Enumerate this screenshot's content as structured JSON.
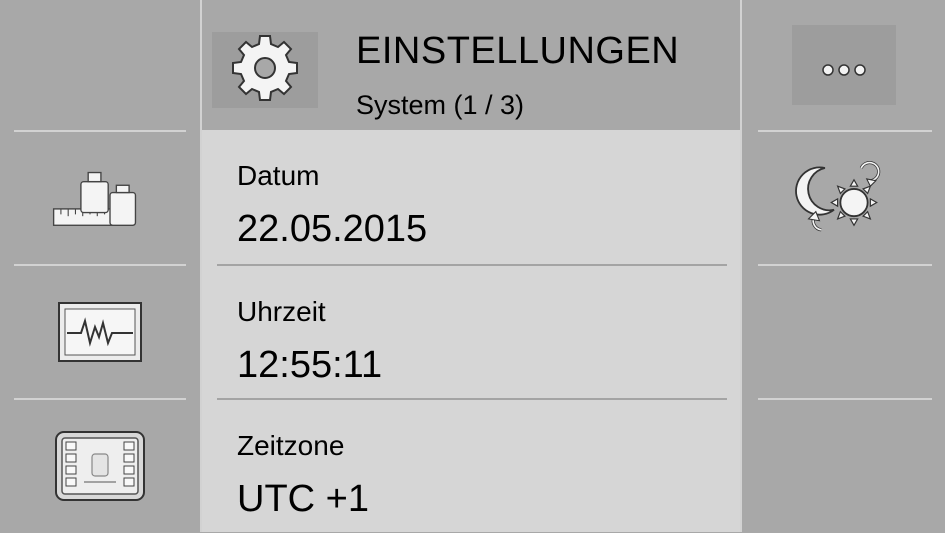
{
  "header": {
    "title": "EINSTELLUNGEN",
    "subtitle": "System (1 / 3)",
    "icon": "gear-icon"
  },
  "settings": [
    {
      "label": "Datum",
      "value": "22.05.2015"
    },
    {
      "label": "Uhrzeit",
      "value": "12:55:11"
    },
    {
      "label": "Zeitzone",
      "value": "UTC +1"
    }
  ],
  "left_buttons": [
    {
      "icon": "weights-scale-icon"
    },
    {
      "icon": "monitor-waveform-icon"
    },
    {
      "icon": "terminal-display-icon"
    }
  ],
  "right_buttons": [
    {
      "icon": "more-dots-icon"
    },
    {
      "icon": "day-night-switch-icon"
    }
  ],
  "colors": {
    "background": "#a8a8a8",
    "panel": "#d6d6d6",
    "separator": "#d2d2d2"
  }
}
